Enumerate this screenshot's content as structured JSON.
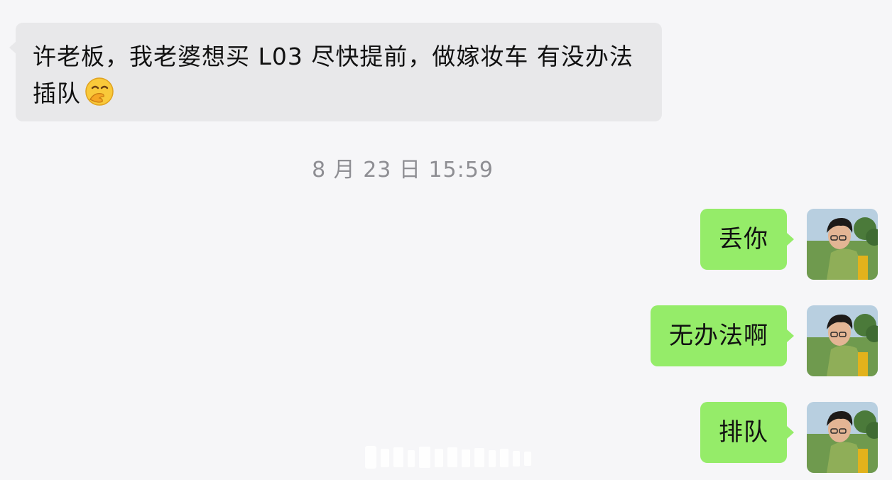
{
  "conversation": {
    "incoming_message": {
      "text": "许老板，我老婆想买 L03  尽快提前，做嫁妆车 有没办法插队",
      "emoji": "hand-over-mouth-face"
    },
    "timestamp": "8 月 23 日 15:59",
    "outgoing_messages": [
      {
        "text": "丢你"
      },
      {
        "text": "无办法啊"
      },
      {
        "text": "排队"
      }
    ]
  },
  "colors": {
    "background": "#f6f6f8",
    "incoming_bubble": "#e8e8ea",
    "outgoing_bubble": "#95ec69",
    "timestamp_text": "#8e8e93"
  }
}
